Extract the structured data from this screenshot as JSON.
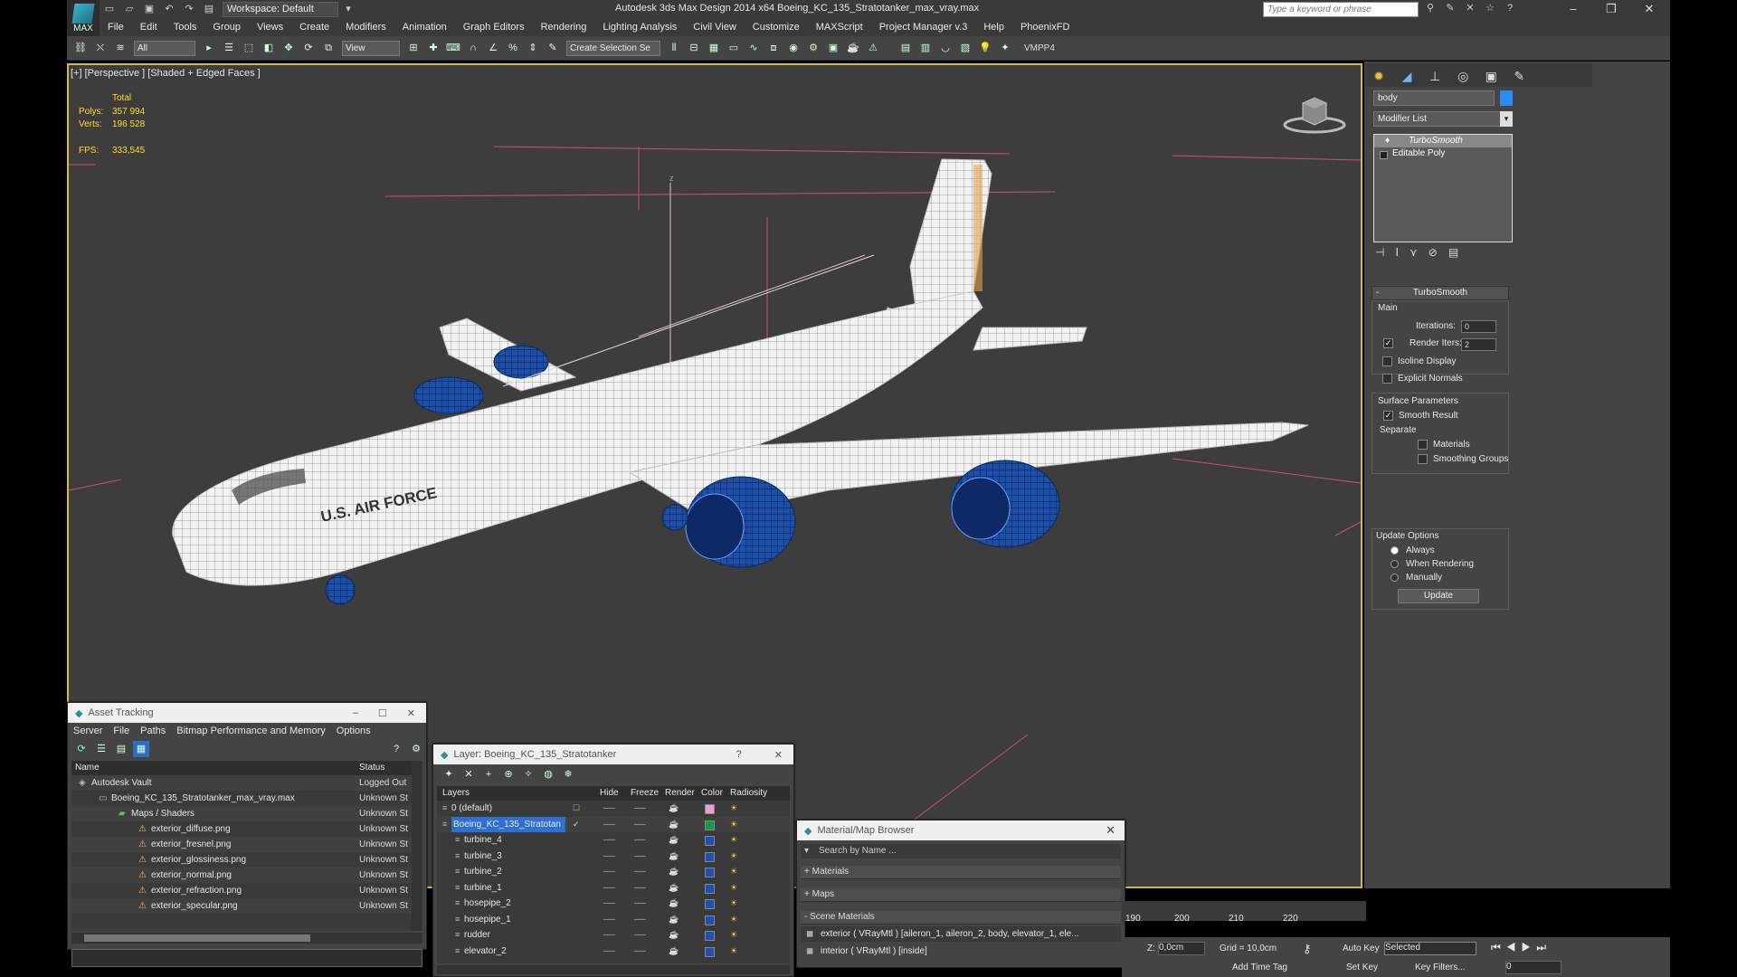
{
  "app": {
    "title": "Autodesk 3ds Max Design 2014 x64     Boeing_KC_135_Stratotanker_max_vray.max",
    "logo_text": "MAX",
    "workspace": "Workspace: Default",
    "search_placeholder": "Type a keyword or phrase"
  },
  "menu": [
    "File",
    "Edit",
    "Tools",
    "Group",
    "Views",
    "Create",
    "Modifiers",
    "Animation",
    "Graph Editors",
    "Rendering",
    "Lighting Analysis",
    "Civil View",
    "Customize",
    "MAXScript",
    "Project Manager v.3",
    "Help",
    "PhoenixFD"
  ],
  "toolbar": {
    "filter": "All",
    "coord": "View",
    "selection_set": "Create Selection Se",
    "vmpp": "VMPP4"
  },
  "viewport": {
    "label": "[+] [Perspective ] [Shaded + Edged Faces ]",
    "stats": {
      "total_label": "Total",
      "polys_label": "Polys:",
      "polys": "357 994",
      "verts_label": "Verts:",
      "verts": "196 528",
      "fps_label": "FPS:",
      "fps": "333,545"
    },
    "fuselage_text": "U.S. AIR FORCE"
  },
  "command_panel": {
    "object_name": "body",
    "modifier_list": "Modifier List",
    "stack": [
      "TurboSmooth",
      "Editable Poly"
    ],
    "turbosmooth": {
      "title": "TurboSmooth",
      "main": "Main",
      "iterations_label": "Iterations:",
      "iterations": "0",
      "render_iters_label": "Render Iters:",
      "render_iters": "2",
      "isoline": "Isoline Display",
      "explicit": "Explicit Normals",
      "surface": "Surface Parameters",
      "smooth_result": "Smooth Result",
      "separate": "Separate",
      "materials": "Materials",
      "smoothing": "Smoothing Groups",
      "update_options": "Update Options",
      "always": "Always",
      "when_rendering": "When Rendering",
      "manually": "Manually",
      "update": "Update"
    }
  },
  "asset_tracking": {
    "title": "Asset Tracking",
    "menu": [
      "Server",
      "File",
      "Paths",
      "Bitmap Performance and Memory",
      "Options"
    ],
    "col_name": "Name",
    "col_status": "Status",
    "rows": [
      {
        "name": "Autodesk Vault",
        "status": "Logged Out",
        "indent": 22,
        "icon": "vault"
      },
      {
        "name": "Boeing_KC_135_Stratotanker_max_vray.max",
        "status": "Unknown St",
        "indent": 44,
        "icon": "file"
      },
      {
        "name": "Maps / Shaders",
        "status": "Unknown St",
        "indent": 66,
        "icon": "folder"
      },
      {
        "name": "exterior_diffuse.png",
        "status": "Unknown St",
        "indent": 88,
        "icon": "png"
      },
      {
        "name": "exterior_fresnel.png",
        "status": "Unknown St",
        "indent": 88,
        "icon": "png"
      },
      {
        "name": "exterior_glossiness.png",
        "status": "Unknown St",
        "indent": 88,
        "icon": "png"
      },
      {
        "name": "exterior_normal.png",
        "status": "Unknown St",
        "indent": 88,
        "icon": "png"
      },
      {
        "name": "exterior_refraction.png",
        "status": "Unknown St",
        "indent": 88,
        "icon": "png"
      },
      {
        "name": "exterior_specular.png",
        "status": "Unknown St",
        "indent": 88,
        "icon": "png"
      }
    ]
  },
  "layer_window": {
    "title": "Layer: Boeing_KC_135_Stratotanker",
    "cols": [
      "Layers",
      "Hide",
      "Freeze",
      "Render",
      "Color",
      "Radiosity"
    ],
    "rows": [
      {
        "name": "0 (default)",
        "color": "#e8a0d0"
      },
      {
        "name": "Boeing_KC_135_Stratotan",
        "color": "#10a040",
        "selected": true
      },
      {
        "name": "turbine_4",
        "color": "#2050b0"
      },
      {
        "name": "turbine_3",
        "color": "#2050b0"
      },
      {
        "name": "turbine_2",
        "color": "#2050b0"
      },
      {
        "name": "turbine_1",
        "color": "#2050b0"
      },
      {
        "name": "hosepipe_2",
        "color": "#2050b0"
      },
      {
        "name": "hosepipe_1",
        "color": "#2050b0"
      },
      {
        "name": "rudder",
        "color": "#2050b0"
      },
      {
        "name": "elevator_2",
        "color": "#2050b0"
      }
    ]
  },
  "material_browser": {
    "title": "Material/Map Browser",
    "search": "Search by Name ...",
    "sections": [
      "+ Materials",
      "+ Maps",
      "- Scene Materials"
    ],
    "materials": [
      "exterior  ( VRayMtl ) [aileron_1, aileron_2, body, elevator_1, ele...",
      "interior  ( VRayMtl ) [inside]"
    ]
  },
  "timeline": {
    "ticks": [
      "190",
      "200",
      "210",
      "220"
    ]
  },
  "status_bar": {
    "z_label": "Z:",
    "z": "0,0cm",
    "grid": "Grid = 10,0cm",
    "auto_key": "Auto Key",
    "selected": "Selected",
    "set_key": "Set Key",
    "key_filters": "Key Filters...",
    "add_time_tag": "Add Time Tag",
    "frame": "0"
  },
  "colors": {
    "accent": "#d8b64b",
    "wire": "#ffffff",
    "engine": "#1d4ea8",
    "grid": "#d0506a"
  }
}
